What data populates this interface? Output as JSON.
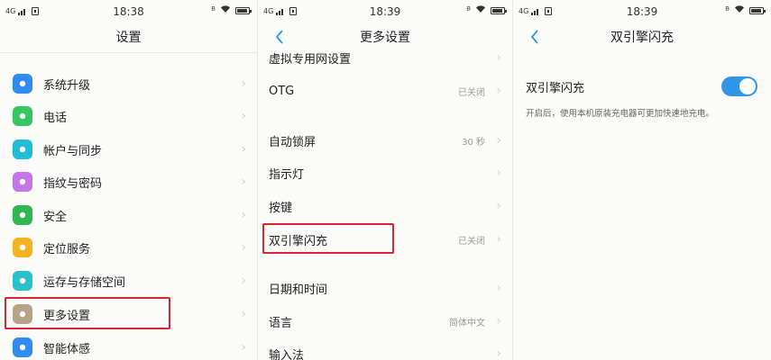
{
  "status_left": "4G",
  "panels": [
    {
      "time": "18:38",
      "title": "设置",
      "items": [
        {
          "label": "系统升级",
          "icon": "system-update-icon",
          "color": "#2f8cf0"
        },
        {
          "label": "电话",
          "icon": "phone-icon",
          "color": "#35c65f"
        },
        {
          "label": "帐户与同步",
          "icon": "cloud-sync-icon",
          "color": "#22bcd6"
        },
        {
          "label": "指纹与密码",
          "icon": "fingerprint-icon",
          "color": "#c476e8"
        },
        {
          "label": "安全",
          "icon": "shield-icon",
          "color": "#2fb84f"
        },
        {
          "label": "定位服务",
          "icon": "location-icon",
          "color": "#f5b322"
        },
        {
          "label": "运存与存储空间",
          "icon": "storage-icon",
          "color": "#2dbfc9"
        },
        {
          "label": "更多设置",
          "icon": "wrench-icon",
          "color": "#b9a386"
        },
        {
          "label": "智能体感",
          "icon": "gesture-icon",
          "color": "#2f8cf0"
        }
      ]
    },
    {
      "time": "18:39",
      "title": "更多设置",
      "items": [
        {
          "label": "虚拟专用网设置",
          "value": ""
        },
        {
          "label": "OTG",
          "value": "已关闭"
        },
        {
          "label": "自动锁屏",
          "value": "30 秒"
        },
        {
          "label": "指示灯",
          "value": ""
        },
        {
          "label": "按键",
          "value": ""
        },
        {
          "label": "双引擎闪充",
          "value": "已关闭"
        },
        {
          "label": "日期和时间",
          "value": ""
        },
        {
          "label": "语言",
          "value": "简体中文"
        },
        {
          "label": "输入法",
          "value": ""
        }
      ]
    },
    {
      "time": "18:39",
      "title": "双引擎闪充",
      "switch_label": "双引擎闪充",
      "switch_on": true,
      "description": "开启后，使用本机原装充电器可更加快速地充电。"
    }
  ],
  "colors": {
    "accent": "#2e96e8",
    "highlight": "#d9262a"
  }
}
